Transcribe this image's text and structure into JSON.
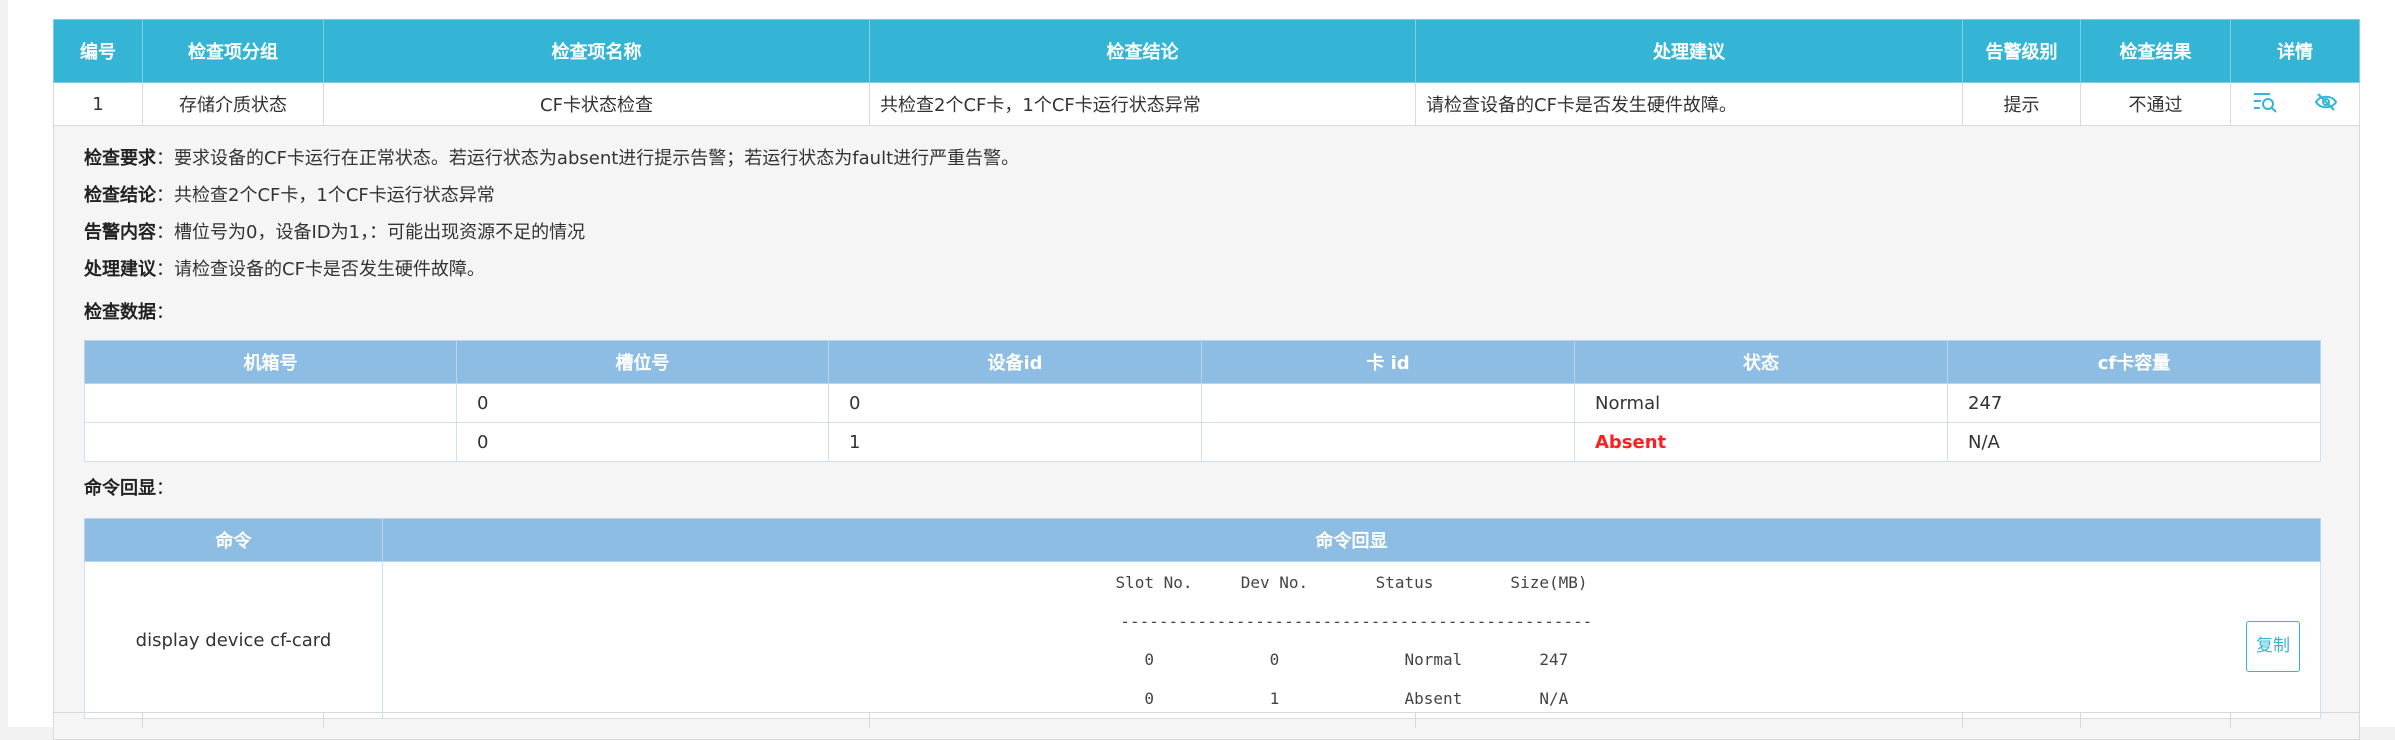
{
  "columns": [
    "编号",
    "检查项分组",
    "检查项名称",
    "检查结论",
    "处理建议",
    "告警级别",
    "检查结果",
    "详情"
  ],
  "row": {
    "id": "1",
    "group": "存储介质状态",
    "name": "CF卡状态检查",
    "conclusion": "共检查2个CF卡，1个CF卡运行状态异常",
    "advice": "请检查设备的CF卡是否发生硬件故障。",
    "level": "提示",
    "result": "不通过",
    "result_color": "#ff1f1f",
    "detail_icons": [
      "list-search-icon",
      "eye-off-icon"
    ]
  },
  "detail": {
    "requirement_label": "检查要求",
    "requirement": "要求设备的CF卡运行在正常状态。若运行状态为absent进行提示告警；若运行状态为fault进行严重告警。",
    "conclusion_label": "检查结论",
    "conclusion": "共检查2个CF卡，1个CF卡运行状态异常",
    "alarm_label": "告警内容",
    "alarm": "槽位号为0，设备ID为1，：可能出现资源不足的情况",
    "advice_label": "处理建议",
    "advice": "请检查设备的CF卡是否发生硬件故障。",
    "data_label": "检查数据",
    "echo_label": "命令回显",
    "colon": "："
  },
  "data_table": {
    "headers": [
      "机箱号",
      "槽位号",
      "设备id",
      "卡 id",
      "状态",
      "cf卡容量"
    ],
    "rows": [
      [
        "",
        "0",
        "0",
        "",
        "Normal",
        "247"
      ],
      [
        "",
        "0",
        "1",
        "",
        "Absent",
        "N/A"
      ]
    ]
  },
  "cmd_table": {
    "headers": [
      "命令",
      "命令回显"
    ],
    "command": "display device cf-card",
    "output_lines": [
      "Slot No.     Dev No.       Status        Size(MB)",
      " -------------------------------------------------",
      " 0            0             Normal        247",
      " 0            1             Absent        N/A"
    ],
    "copy_label": "复制"
  }
}
